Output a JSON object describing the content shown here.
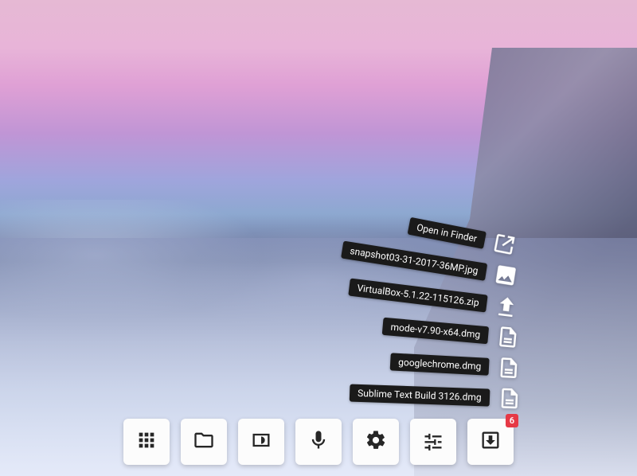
{
  "files": [
    {
      "label": "Sublime Text Build 3126.dmg",
      "icon": "file"
    },
    {
      "label": "googlechrome.dmg",
      "icon": "file"
    },
    {
      "label": "mode-v7.90-x64.dmg",
      "icon": "file"
    },
    {
      "label": "VirtualBox-5.1.22-115126.zip",
      "icon": "upload"
    },
    {
      "label": "snapshot03-31-2017-36MP.jpg",
      "icon": "image"
    },
    {
      "label": "Open in Finder",
      "icon": "external"
    }
  ],
  "dock": {
    "apps_label": "Apps",
    "files_label": "Files",
    "display_label": "Display",
    "voice_label": "Voice",
    "settings_label": "Settings",
    "tuner_label": "Tuner",
    "downloads_label": "Downloads",
    "downloads_badge": "6"
  }
}
